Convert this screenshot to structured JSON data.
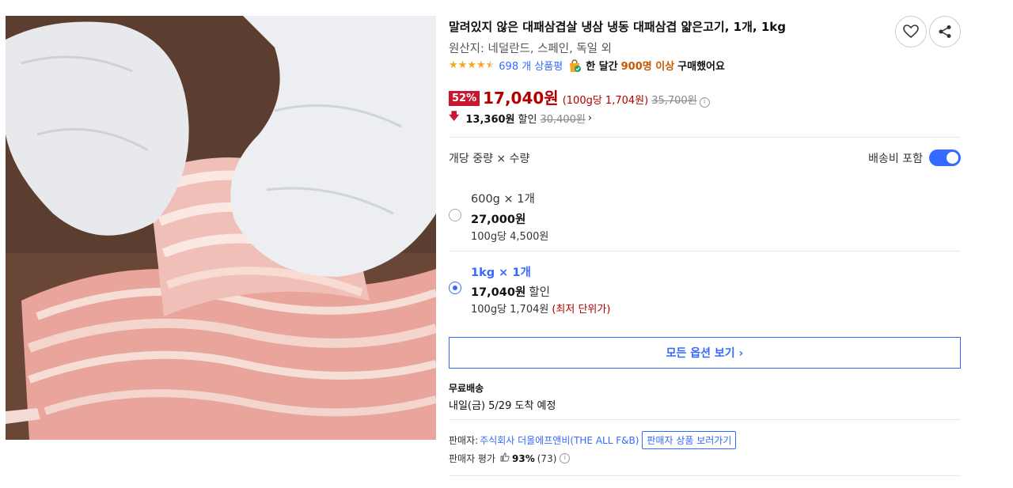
{
  "product": {
    "title": "말려있지 않은 대패삼겹살 냉삼 냉동 대패삼겹 얇은고기, 1개, 1kg",
    "origin": "원산지: 네덜란드, 스페인, 독일 외",
    "rating_stars": 4.5,
    "review_count": "698 개 상품평",
    "monthly_prefix": "한 달간",
    "monthly_count": "900명 이상",
    "monthly_suffix": "구매했어요",
    "image_icon": "pork-belly-photo"
  },
  "price": {
    "discount_rate": "52%",
    "sale_price": "17,040원",
    "unit_price": "(100g당 1,704원)",
    "original_price": "35,700원",
    "cut_amount": "13,360원",
    "cut_label": "할인",
    "cut_original": "30,400원",
    "cut_chevron": "›",
    "down_arrow": "🡇"
  },
  "options": {
    "header_label": "개당 중량 × 수량",
    "shipping_toggle_label": "배송비 포함",
    "shipping_toggle_on": true,
    "items": [
      {
        "name": "600g × 1개",
        "price": "27,000원",
        "price_tag": "",
        "unit": "100g당 4,500원",
        "unit_note": "",
        "selected": false
      },
      {
        "name": "1kg × 1개",
        "price": "17,040원",
        "price_tag": "할인",
        "unit": "100g당 1,704원",
        "unit_note": "(최저 단위가)",
        "selected": true
      }
    ],
    "all_options_label": "모든 옵션 보기 ›"
  },
  "delivery": {
    "free_shipping": "무료배송",
    "arrival": "내일(금) 5/29 도착 예정"
  },
  "seller": {
    "label": "판매자:",
    "name": "주식회사 더올에프앤비(THE ALL F&B)",
    "button": "판매자 상품 보러가기",
    "rating_label": "판매자 평가",
    "rating_pct": "93%",
    "rating_count": "(73)"
  },
  "colors": {
    "accent_blue": "#346aff",
    "price_red": "#ae0000",
    "badge_red": "#c8172e",
    "star_orange": "#f5a623"
  }
}
